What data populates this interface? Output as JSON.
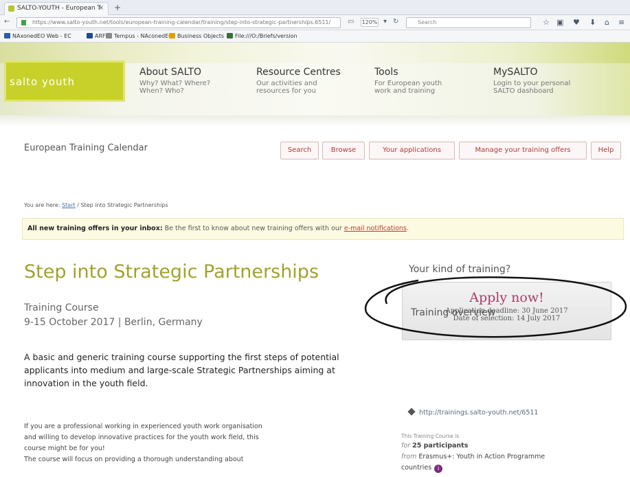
{
  "browser": {
    "tab_title": "SALTO-YOUTH - European T",
    "tab_close": "×",
    "new_tab": "+",
    "url": "https://www.salto-youth.net/tools/european-training-calendar/training/step-into-strategic-partnerships.6511/",
    "zoom": "120%",
    "search_placeholder": "Search",
    "bookmarks": [
      {
        "label": "NAxonedEO Web - EC",
        "color": "#2a5da8"
      },
      {
        "label": "ARF",
        "color": "#1e4a8f"
      },
      {
        "label": "Tempus - NAconedEO",
        "color": "#888888"
      },
      {
        "label": "Business Objects",
        "color": "#e0a000"
      },
      {
        "label": "File:///O:/Briefs/version",
        "color": "#3a6e3a"
      }
    ]
  },
  "site": {
    "logo": "salto youth",
    "menu": [
      {
        "title": "About SALTO",
        "sub1": "Why? What? Where?",
        "sub2": "When? Who?"
      },
      {
        "title": "Resource Centres",
        "sub1": "Our activities and",
        "sub2": "resources for you"
      },
      {
        "title": "Tools",
        "sub1": "For European youth",
        "sub2": "work and training"
      },
      {
        "title": "MySALTO",
        "sub1": "Login to your personal",
        "sub2": "SALTO dashboard"
      }
    ]
  },
  "calendar": {
    "title": "European Training Calendar",
    "buttons": [
      "Search",
      "Browse",
      "Your applications",
      "Manage your training offers",
      "Help"
    ]
  },
  "breadcrumb": {
    "prefix": "You are here:",
    "start": "Start",
    "separator": "/",
    "current": "Step into Strategic Partnerships"
  },
  "notice": {
    "bold": "All new training offers in your inbox:",
    "text": " Be the first to know about new training offers with our ",
    "link": "e-mail notifications",
    "end": "."
  },
  "main": {
    "title": "Step into Strategic Partnerships",
    "type": "Training Course",
    "date_place": "9-15 October 2017 | Berlin, Germany",
    "summary": "A basic and generic training course supporting the first steps of potential applicants into medium and large-scale Strategic Partnerships aiming at innovation in the youth field.",
    "body_line1": "If you are a professional working in experienced youth work organisation",
    "body_line2": "and willing to develop innovative practices for the youth work field, this",
    "body_line3": "course might be for you!",
    "body_line4": "The course will focus on providing a thorough understanding about"
  },
  "sidebar": {
    "kind_title": "Your kind of training?",
    "apply_label": "Apply now!",
    "deadline": "Application deadline: 30 June 2017",
    "selection": "Date of selection: 14 July 2017",
    "overview_title": "Training overview",
    "overview_link": "http://trainings.salto-youth.net/6511",
    "small_label": "This Training Course is",
    "for_prefix": "for",
    "participants": "25 participants",
    "from_prefix": "from",
    "from_text": "Erasmus+: Youth in Action Programme",
    "countries": "countries",
    "info_icon": "i"
  }
}
